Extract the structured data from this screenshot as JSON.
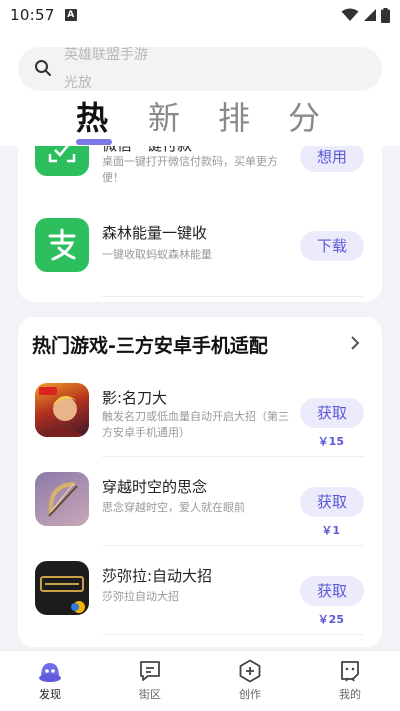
{
  "status_bar": {
    "time": "10:57",
    "notif_icon": "A"
  },
  "search": {
    "rolling_texts": [
      "英雄联盟手游",
      "光放"
    ]
  },
  "tabs": [
    {
      "label": "热",
      "active": true
    },
    {
      "label": "新",
      "active": false
    },
    {
      "label": "排",
      "active": false
    },
    {
      "label": "分",
      "active": false
    }
  ],
  "card_a": {
    "rows": [
      {
        "name": "微信一键付款",
        "desc": "桌面一键打开微信付款码，买单更方便！",
        "button": "想用"
      },
      {
        "name": "森林能量一键收",
        "desc": "一键收取蚂蚁森林能量",
        "button": "下载"
      }
    ]
  },
  "card_b": {
    "title": "热门游戏-三方安卓手机适配",
    "rows": [
      {
        "name": "影:名刀大",
        "desc": "触发名刀或低血量自动开启大招（第三方安卓手机通用）",
        "button": "获取",
        "price": "￥15"
      },
      {
        "name": "穿越时空的思念",
        "desc": "思念穿越时空，爱人就在眼前",
        "button": "获取",
        "price": "￥1"
      },
      {
        "name": "莎弥拉:自动大招",
        "desc": "莎弥拉自动大招",
        "button": "获取",
        "price": "￥25"
      }
    ]
  },
  "bottom_nav": [
    {
      "label": "发现",
      "icon": "discover-icon",
      "active": true
    },
    {
      "label": "街区",
      "icon": "street-icon",
      "active": false
    },
    {
      "label": "创作",
      "icon": "create-icon",
      "active": false
    },
    {
      "label": "我的",
      "icon": "profile-icon",
      "active": false
    }
  ],
  "colors": {
    "accent": "#5b58d6",
    "accent_bg": "#ecebfb",
    "green": "#2dbf5e",
    "tab_underline": "#7b79e6"
  }
}
